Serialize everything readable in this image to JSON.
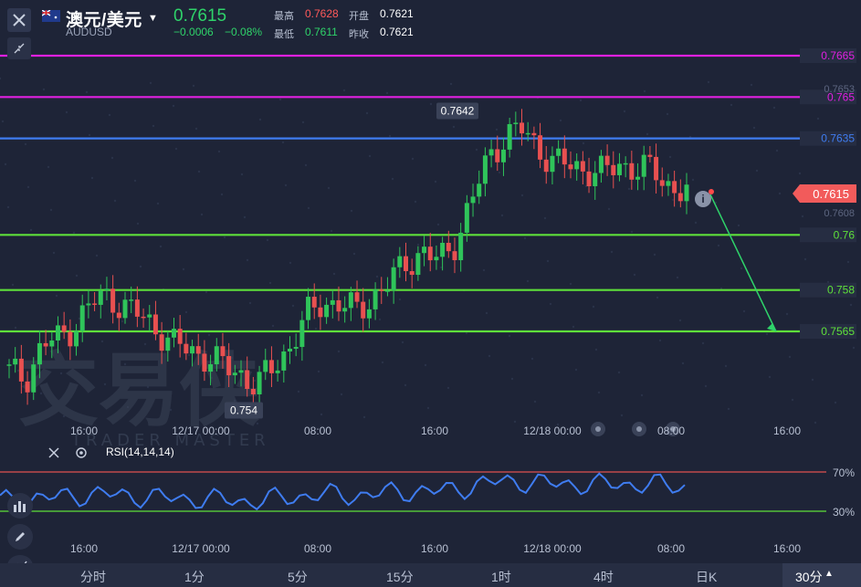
{
  "header": {
    "symbol_title": "澳元/美元",
    "symbol_code": "AUDUSD",
    "last_price": "0.7615",
    "change": "−0.0006",
    "change_pct": "−0.08%",
    "stats": [
      {
        "label": "最高",
        "value": "0.7628",
        "color": "#ff5a5a"
      },
      {
        "label": "开盘",
        "value": "0.7621",
        "color": "#ffffff"
      },
      {
        "label": "最低",
        "value": "0.7611",
        "color": "#2fd36a"
      },
      {
        "label": "昨收",
        "value": "0.7621",
        "color": "#ffffff"
      }
    ]
  },
  "price_levels": [
    {
      "label": "0.7665",
      "value": 0.7665,
      "color": "#e020e0"
    },
    {
      "label": "0.765",
      "value": 0.765,
      "color": "#e020e0"
    },
    {
      "label": "0.7635",
      "value": 0.7635,
      "color": "#3f7cf0"
    },
    {
      "label": "0.76",
      "value": 0.76,
      "color": "#5ee03a"
    },
    {
      "label": "0.758",
      "value": 0.758,
      "color": "#5ee03a"
    },
    {
      "label": "0.7565",
      "value": 0.7565,
      "color": "#5ee03a"
    }
  ],
  "axis_labels": {
    "y_ticks": [
      "0.7653",
      "0.7608"
    ],
    "current_price_tag": "0.7615"
  },
  "annotations": {
    "high_label": "0.7642",
    "low_label": "0.754"
  },
  "watermark": {
    "cn": "交易侠",
    "en": "TRADER MASTER"
  },
  "x_axis": [
    "16:00",
    "12/17 00:00",
    "08:00",
    "16:00",
    "12/18 00:00",
    "08:00",
    "16:00"
  ],
  "rsi": {
    "title": "RSI(14,14,14)",
    "levels": [
      "70%",
      "30%"
    ],
    "color_high": "#e05050",
    "color_low": "#5ee03a",
    "line_color": "#3f7cf0"
  },
  "chart_data": {
    "type": "candlestick",
    "symbol": "AUDUSD",
    "ohlc_close_path": [
      0.755,
      0.7548,
      0.756,
      0.7562,
      0.7568,
      0.7575,
      0.7578,
      0.7574,
      0.757,
      0.7566,
      0.756,
      0.7558,
      0.7556,
      0.7552,
      0.755,
      0.7545,
      0.7552,
      0.756,
      0.757,
      0.7576,
      0.7575,
      0.7572,
      0.7578,
      0.7582,
      0.759,
      0.7594,
      0.759,
      0.7598,
      0.7612,
      0.7628,
      0.7636,
      0.7638,
      0.7632,
      0.7626,
      0.7625,
      0.7624,
      0.7622,
      0.7626,
      0.7624,
      0.7623,
      0.7618,
      0.7615
    ],
    "annotated_high": 0.7642,
    "annotated_low": 0.754,
    "horizontal_levels": [
      0.7665,
      0.765,
      0.7635,
      0.76,
      0.758,
      0.7565
    ]
  },
  "timeframes": [
    "分时",
    "1分",
    "5分",
    "15分",
    "1时",
    "4时",
    "日K",
    "30分"
  ],
  "active_timeframe": "30分"
}
